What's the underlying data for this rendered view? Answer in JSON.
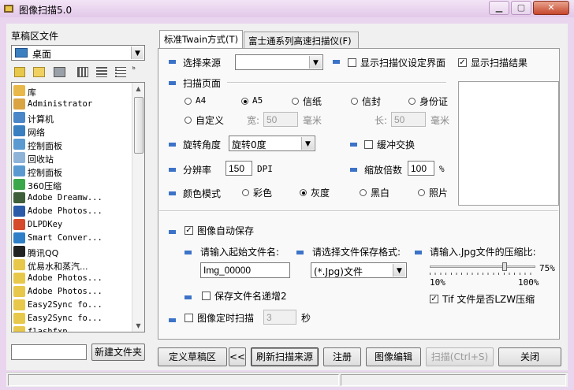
{
  "window": {
    "title": "图像扫描5.0"
  },
  "left_panel": {
    "group_label": "草稿区文件",
    "drive_value": "桌面",
    "tree_items": [
      {
        "label": "库",
        "color": "#e8b84a"
      },
      {
        "label": "Administrator",
        "color": "#d9a441"
      },
      {
        "label": "计算机",
        "color": "#4a86c8"
      },
      {
        "label": "网络",
        "color": "#3a7fc0"
      },
      {
        "label": "控制面板",
        "color": "#5a9ad0"
      },
      {
        "label": "回收站",
        "color": "#8fb4d8"
      },
      {
        "label": "控制面板",
        "color": "#5a9ad0"
      },
      {
        "label": "360压缩",
        "color": "#3aa84a"
      },
      {
        "label": "Adobe Dreamw...",
        "color": "#3f5e3a"
      },
      {
        "label": "Adobe Photos...",
        "color": "#2a5aa8"
      },
      {
        "label": "DLPDKey",
        "color": "#d44a2a"
      },
      {
        "label": "Smart Conver...",
        "color": "#2f7fc8"
      },
      {
        "label": "腾讯QQ",
        "color": "#222222"
      },
      {
        "label": "优易水和蒸汽...",
        "color": "#e8c84a"
      },
      {
        "label": "Adobe Photos...",
        "color": "#e8c84a"
      },
      {
        "label": "Adobe Photos...",
        "color": "#e8c84a"
      },
      {
        "label": "Easy2Sync fo...",
        "color": "#e8c84a"
      },
      {
        "label": "Easy2Sync fo...",
        "color": "#e8c84a"
      },
      {
        "label": "flashfxp",
        "color": "#e8c84a"
      }
    ],
    "new_folder_label": "新建文件夹",
    "new_folder_value": ""
  },
  "tabs": [
    {
      "label": "标准Twain方式(T)"
    },
    {
      "label": "富士通系列高速扫描仪(F)"
    }
  ],
  "scan": {
    "source_label": "选择来源",
    "source_value": "",
    "show_settings_label": "显示扫描仪设定界面",
    "show_settings_checked": false,
    "show_result_label": "显示扫描结果",
    "show_result_checked": true,
    "page_label": "扫描页面",
    "page_options": [
      "A4",
      "A5",
      "信纸",
      "信封",
      "身份证",
      "自定义"
    ],
    "page_selected": "A5",
    "width_label": "宽:",
    "width_value": "50",
    "height_label": "长:",
    "height_value": "50",
    "unit_mm": "毫米",
    "rotate_label": "旋转角度",
    "rotate_value": "旋转0度",
    "buffer_label": "缓冲交换",
    "buffer_checked": false,
    "resolution_label": "分辨率",
    "resolution_value": "150",
    "dpi": "DPI",
    "zoom_label": "缩放倍数",
    "zoom_value": "100",
    "percent": "%",
    "color_label": "颜色模式",
    "color_options": [
      "彩色",
      "灰度",
      "黑白",
      "照片"
    ],
    "color_selected": "灰度"
  },
  "save": {
    "auto_save_label": "图像自动保存",
    "auto_save_checked": true,
    "filename_label": "请输入起始文件名:",
    "filename_value": "Img_00000",
    "format_label": "请选择文件保存格式:",
    "format_value": "(*.Jpg)文件",
    "jpg_label": "请输入.Jpg文件的压缩比:",
    "jpg_value_label": "75%",
    "jpg_value": 75,
    "slider_min": "10%",
    "slider_max": "100%",
    "increment_label": "保存文件名递增2",
    "increment_checked": false,
    "tif_label": "Tif 文件是否LZW压缩",
    "tif_checked": true,
    "timer_label": "图像定时扫描",
    "timer_checked": false,
    "timer_value": "3",
    "timer_unit": "秒"
  },
  "buttons": {
    "define_draft": "定义草稿区",
    "collapse": "<<",
    "refresh": "刷新扫描来源",
    "register": "注册",
    "edit": "图像编辑",
    "scan": "扫描(Ctrl+S)",
    "close": "关闭"
  }
}
